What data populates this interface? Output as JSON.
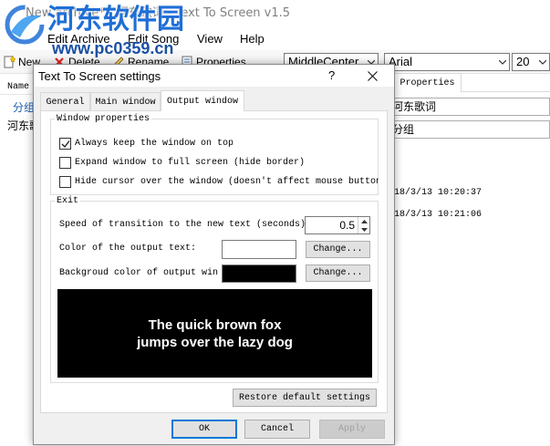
{
  "app": {
    "title": "New archive* - 河东歌词 - Text To Screen v1.5"
  },
  "watermark": {
    "brand": "河东软件园",
    "url": "www.pc0359.cn"
  },
  "menu": {
    "items": [
      {
        "label": "Edit Archive"
      },
      {
        "label": "Edit Song"
      },
      {
        "label": "View"
      },
      {
        "label": "Help"
      }
    ]
  },
  "toolbar": {
    "new_label": "New",
    "delete_label": "Delete",
    "rename_label": "Rename",
    "properties_label": "Properties",
    "alignment_value": "MiddleCenter",
    "font_value": "Arial",
    "font_size_value": "20"
  },
  "song_list": {
    "column_header": "Name",
    "items": [
      {
        "label": "分组"
      },
      {
        "label": "河东歌"
      }
    ]
  },
  "properties_panel": {
    "tab_label": "Properties",
    "name_value": "河东歌词",
    "group_value": "分组",
    "created_value": "18/3/13 10:20:37",
    "modified_value": "18/3/13 10:21:06"
  },
  "dialog": {
    "title": "Text To Screen settings",
    "help_label": "?",
    "tabs": [
      {
        "label": "General",
        "selected": false
      },
      {
        "label": "Main window",
        "selected": false
      },
      {
        "label": "Output window",
        "selected": true
      }
    ],
    "window_properties": {
      "legend": "Window properties",
      "options": [
        {
          "label": "Always keep the window on top",
          "checked": true
        },
        {
          "label": "Expand window to full screen (hide border)",
          "checked": false
        },
        {
          "label": "Hide cursor over the window (doesn't affect mouse button",
          "checked": false
        }
      ]
    },
    "exit": {
      "legend": "Exit",
      "speed_label": "Speed of transition to the new text (seconds)",
      "speed_value": "0.5",
      "text_color_label": "Color of the output text:",
      "text_color": "#ffffff",
      "text_color_button": "Change...",
      "background_color_label": "Backgroud color of output win",
      "background_color": "#000000",
      "background_color_button": "Change...",
      "preview_lines": [
        "The quick brown fox",
        "jumps over the lazy dog"
      ]
    },
    "restore_button": "Restore default settings",
    "ok_button": "OK",
    "cancel_button": "Cancel",
    "apply_button": "Apply",
    "apply_enabled": false
  },
  "colors": {
    "accent": "#0078d7",
    "watermark_blue": "#1f6fd6",
    "dialog_background": "#f0f0f0",
    "list_selection_text": "#1a5fb4"
  },
  "icons": {
    "new": "new-icon",
    "delete": "delete-icon",
    "rename": "rename-icon",
    "properties": "properties-icon",
    "dropdown": "chevron-down-icon",
    "close": "close-icon",
    "check": "checkmark-icon",
    "spin_up": "spin-up-icon",
    "spin_down": "spin-down-icon",
    "watermark_logo": "bird-logo-icon"
  }
}
